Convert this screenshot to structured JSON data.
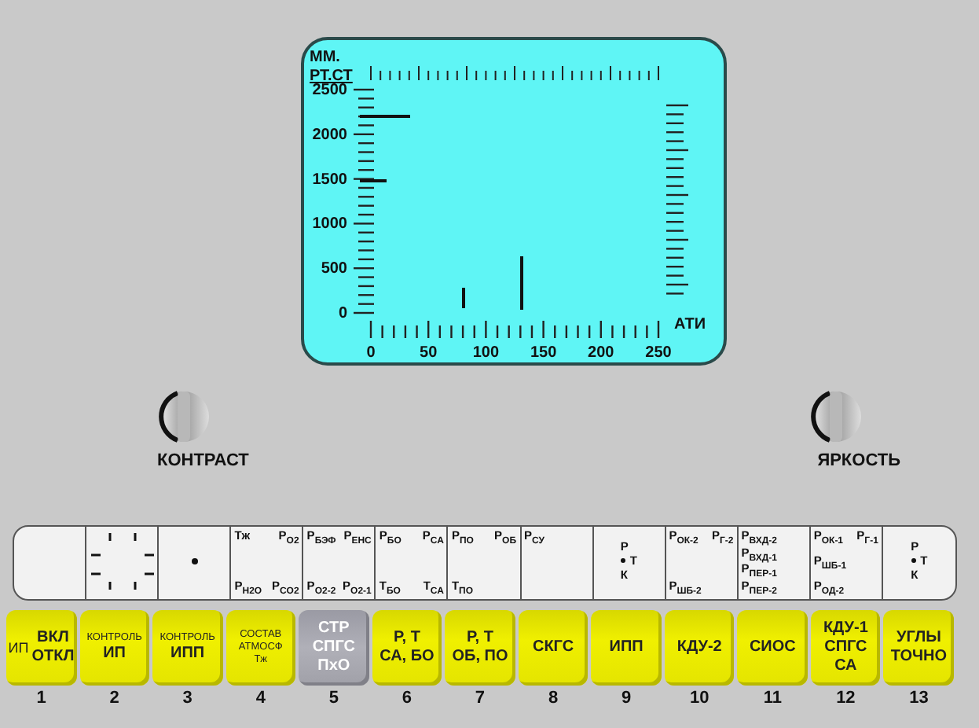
{
  "display": {
    "y_unit": [
      "ММ.",
      "РТ.СТ"
    ],
    "x_unit": "АТИ",
    "y_labels": [
      "2500",
      "2000",
      "1500",
      "1000",
      "500",
      "0"
    ],
    "x_labels": [
      "0",
      "50",
      "100",
      "150",
      "200",
      "250"
    ]
  },
  "knobs": [
    {
      "label": "КОНТРАСТ"
    },
    {
      "label": "ЯРКОСТЬ"
    }
  ],
  "indicator_cells": [
    {
      "kind": "blank"
    },
    {
      "kind": "ticks"
    },
    {
      "kind": "dot"
    },
    {
      "kind": "labels",
      "labels": [
        "Tж",
        "P$_{O2}$",
        "P$_{H2O}$",
        "P$_{CO2}$"
      ]
    },
    {
      "kind": "labels",
      "labels": [
        "P$_{БЭФ}$",
        "P$_{ЕНС}$",
        "P$_{O2-2}$",
        "P$_{O2-1}$"
      ]
    },
    {
      "kind": "labels",
      "labels": [
        "P$_{БО}$",
        "P$_{СА}$",
        "T$_{БО}$",
        "T$_{СА}$"
      ]
    },
    {
      "kind": "labels",
      "labels": [
        "P$_{ПО}$",
        "P$_{ОБ}$",
        "T$_{ПО}$"
      ]
    },
    {
      "kind": "labels",
      "labels": [
        "P$_{СУ}$"
      ]
    },
    {
      "kind": "ptk",
      "labels": [
        "P",
        "T",
        "К"
      ]
    },
    {
      "kind": "labels",
      "labels": [
        "P$_{ОК-2}$",
        "P$_{Г-2}$",
        "P$_{ШБ-2}$"
      ]
    },
    {
      "kind": "labels",
      "labels": [
        "P$_{ВХД-2}$",
        "P$_{ВХД-1}$",
        "P$_{ПЕР-1}$",
        "P$_{ПЕР-2}$"
      ]
    },
    {
      "kind": "labels",
      "labels": [
        "P$_{ОК-1}$",
        "P$_{Г-1}$",
        "P$_{ШБ-1}$",
        "P$_{ОД-2}$"
      ]
    },
    {
      "kind": "ptk",
      "labels": [
        "P",
        "T",
        "К"
      ]
    }
  ],
  "buttons": [
    {
      "prefix": "ИП",
      "lines": [
        {
          "text": "ВКЛ",
          "small": false
        },
        {
          "text": "ОТКЛ",
          "small": false
        }
      ],
      "selected": false
    },
    {
      "lines": [
        {
          "text": "КОНТРОЛЬ",
          "small": true
        },
        {
          "text": "ИП",
          "small": false
        }
      ],
      "selected": false
    },
    {
      "lines": [
        {
          "text": "КОНТРОЛЬ",
          "small": true
        },
        {
          "text": "ИПП",
          "small": false
        }
      ],
      "selected": false
    },
    {
      "lines": [
        {
          "text": "СОСТАВ",
          "small": true
        },
        {
          "text": "АТМОСФ",
          "small": true
        },
        {
          "text": "Tж",
          "small": true
        }
      ],
      "selected": false
    },
    {
      "lines": [
        {
          "text": "СТР",
          "small": false
        },
        {
          "text": "СПГС",
          "small": false
        },
        {
          "text": "ПхО",
          "small": false
        }
      ],
      "selected": true
    },
    {
      "lines": [
        {
          "text": "Р, Т",
          "small": false
        },
        {
          "text": "СА, БО",
          "small": false
        }
      ],
      "selected": false
    },
    {
      "lines": [
        {
          "text": "Р, Т",
          "small": false
        },
        {
          "text": "ОБ, ПО",
          "small": false
        }
      ],
      "selected": false
    },
    {
      "lines": [
        {
          "text": "СКГС",
          "small": false
        }
      ],
      "selected": false
    },
    {
      "lines": [
        {
          "text": "ИПП",
          "small": false
        }
      ],
      "selected": false
    },
    {
      "lines": [
        {
          "text": "КДУ-2",
          "small": false
        }
      ],
      "selected": false
    },
    {
      "lines": [
        {
          "text": "СИОС",
          "small": false
        }
      ],
      "selected": false
    },
    {
      "lines": [
        {
          "text": "КДУ-1",
          "small": false
        },
        {
          "text": "СПГС",
          "small": false
        },
        {
          "text": "СА",
          "small": false
        }
      ],
      "selected": false
    },
    {
      "lines": [
        {
          "text": "УГЛЫ",
          "small": false
        },
        {
          "text": "ТОЧНО",
          "small": false
        }
      ],
      "selected": false
    }
  ],
  "button_numbers": [
    "1",
    "2",
    "3",
    "4",
    "5",
    "6",
    "7",
    "8",
    "9",
    "10",
    "11",
    "12",
    "13"
  ]
}
